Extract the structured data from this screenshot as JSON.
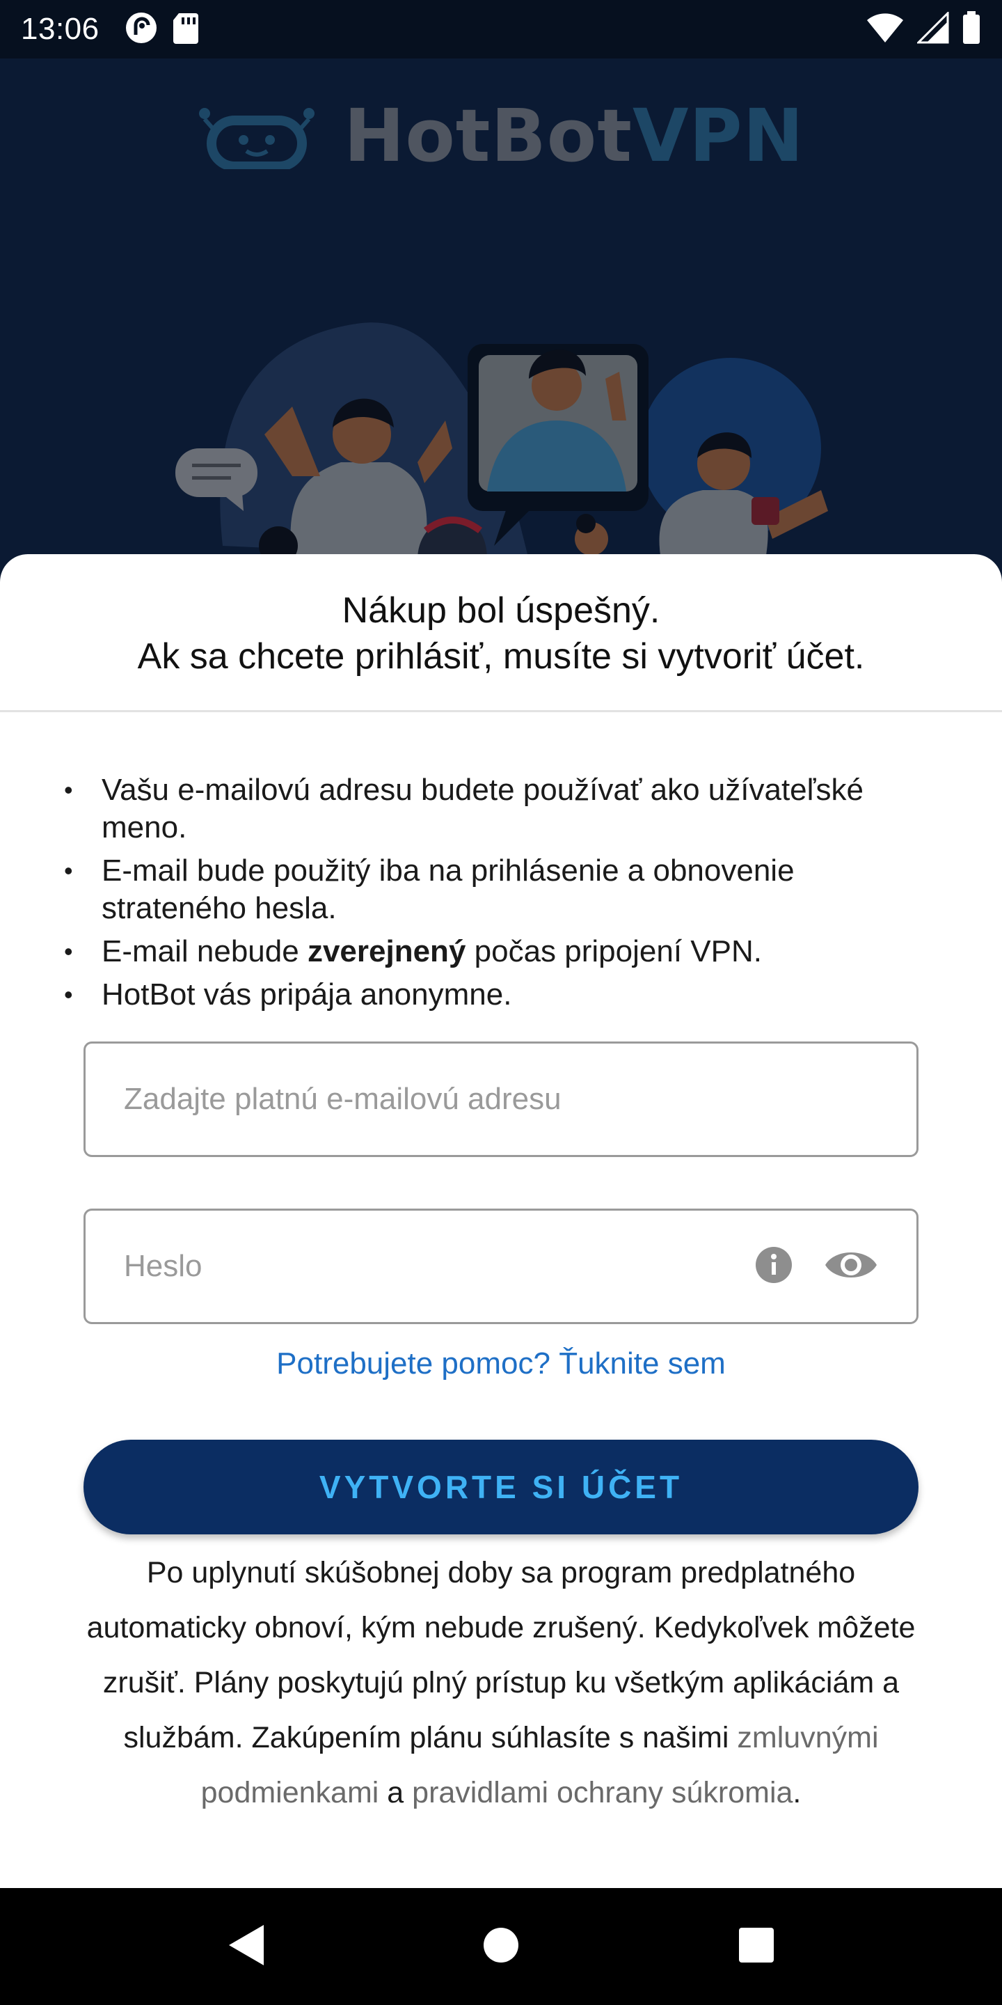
{
  "status_bar": {
    "time": "13:06"
  },
  "brand": {
    "name_part1": "HotBot",
    "name_part2": "VPN"
  },
  "sheet": {
    "title_line1": "Nákup bol úspešný.",
    "title_line2": "Ak sa chcete prihlásiť, musíte si vytvoriť účet.",
    "bullets": [
      "Vašu e-mailovú adresu budete používať ako užívateľské meno.",
      "E-mail bude použitý iba na prihlásenie a obnovenie strateného hesla.",
      {
        "before": "E-mail nebude ",
        "bold": "zverejnený",
        "after": " počas pripojení VPN."
      },
      "HotBot vás pripája anonymne."
    ],
    "email_placeholder": "Zadajte platnú e-mailovú adresu",
    "password_placeholder": "Heslo",
    "help_link": "Potrebujete pomoc? Ťuknite sem",
    "cta_label": "VYTVORTE SI ÚČET",
    "terms": {
      "text": "Po uplynutí skúšobnej doby sa program predplatného automaticky obnoví, kým nebude zrušený. Kedykoľvek môžete zrušiť. Plány poskytujú plný prístup ku všetkým aplikáciám a službám. Zakúpením plánu súhlasíte s našimi ",
      "link1": "zmluvnými podmienkami",
      "middle": " a ",
      "link2": "pravidlami ochrany súkromia",
      "end": "."
    }
  },
  "icons": {
    "status_left": [
      "pocket-casts-icon",
      "sd-card-icon"
    ],
    "status_right": [
      "wifi-icon",
      "signal-icon",
      "battery-icon"
    ],
    "password": [
      "info-icon",
      "eye-icon"
    ],
    "nav": [
      "back-icon",
      "home-icon",
      "recents-icon"
    ]
  },
  "colors": {
    "cta_bg": "#0b2d62",
    "cta_text": "#3fb2f5",
    "link": "#1e6fc6",
    "hero_bg": "#0b1a33"
  }
}
